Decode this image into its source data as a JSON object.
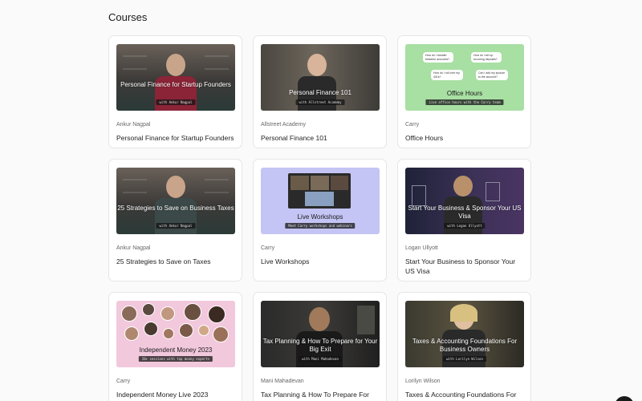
{
  "page": {
    "title": "Courses"
  },
  "courses": [
    {
      "author": "Ankur Nagpal",
      "title": "Personal Finance for Startup Founders",
      "thumb_title": "Personal Finance for Startup Founders",
      "thumb_tag": "with Ankur Nagpal"
    },
    {
      "author": "Allstreet Academy",
      "title": "Personal Finance 101",
      "thumb_title": "Personal Finance 101",
      "thumb_tag": "with Allstreet Academy"
    },
    {
      "author": "Carry",
      "title": "Office Hours",
      "thumb_title": "Office Hours",
      "thumb_tag": "Live office hours with the Carry team",
      "bubbles": [
        "How do I transfer between accounts?",
        "How do I set up recurring deposits?",
        "How do I roll over my 401k?",
        "Can I add my spouse to the account?"
      ]
    },
    {
      "author": "Ankur Nagpal",
      "title": "25 Strategies to Save on Taxes",
      "thumb_title": "25 Strategies to Save on Business Taxes",
      "thumb_tag": "with Ankur Nagpal"
    },
    {
      "author": "Carry",
      "title": "Live Workshops",
      "thumb_title": "Live Workshops",
      "thumb_tag": "Meet Carry workshops and webinars"
    },
    {
      "author": "Logan Ullyott",
      "title": "Start Your Business to Sponsor Your US Visa",
      "thumb_title": "Start Your Business & Sponsor Your US Visa",
      "thumb_tag": "with Logan Ullyott"
    },
    {
      "author": "Carry",
      "title": "Independent Money Live 2023",
      "thumb_title": "Independent Money 2023",
      "thumb_tag": "20+ sessions with top money experts"
    },
    {
      "author": "Mani Mahadevan",
      "title": "Tax Planning & How To Prepare For Your Big Exit",
      "thumb_title": "Tax Planning & How To Prepare for Your Big Exit",
      "thumb_tag": "with Mani Mahadevan"
    },
    {
      "author": "Lorilyn Wilson",
      "title": "Taxes & Accounting Foundations For Business Owners",
      "thumb_title": "Taxes & Accounting Foundations For Business Owners",
      "thumb_tag": "with Lorilyn Wilson"
    }
  ]
}
